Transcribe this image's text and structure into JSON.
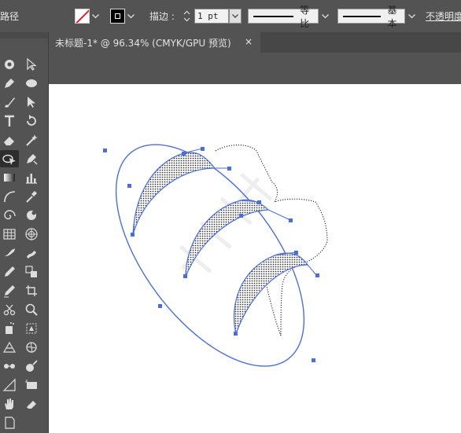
{
  "control_bar": {
    "object_type_label": "路径",
    "stroke_label": "描边 :",
    "stroke_weight": "1 pt",
    "variable_width_label": "等比",
    "brush_label": "基本",
    "opacity_label": "不透明度"
  },
  "document_tab": {
    "title": "未标题-1* @ 96.34% (CMYK/GPU 预览)",
    "close_symbol": "×"
  },
  "colors": {
    "panel": "#535353",
    "selection": "#4b6fd6",
    "artboard": "#ffffff"
  },
  "tools": [
    {
      "name": "direct-selection-tool-icon"
    },
    {
      "name": "selection-tool-icon"
    },
    {
      "name": "pen-tool-icon"
    },
    {
      "name": "ellipse-tool-icon"
    },
    {
      "name": "paintbrush-tool-icon"
    },
    {
      "name": "arrow-tool-icon"
    },
    {
      "name": "type-tool-icon"
    },
    {
      "name": "rotate-tool-icon"
    },
    {
      "name": "eraser-tool-icon"
    },
    {
      "name": "magic-wand-tool-icon"
    },
    {
      "name": "shape-builder-tool-icon"
    },
    {
      "name": "anchor-tool-icon"
    },
    {
      "name": "gradient-tool-icon"
    },
    {
      "name": "column-graph-tool-icon"
    },
    {
      "name": "arc-tool-icon"
    },
    {
      "name": "eyedropper-tool-icon"
    },
    {
      "name": "spiral-tool-icon"
    },
    {
      "name": "blend-tool-icon"
    },
    {
      "name": "grid-tool-icon"
    },
    {
      "name": "polar-grid-tool-icon"
    }
  ]
}
